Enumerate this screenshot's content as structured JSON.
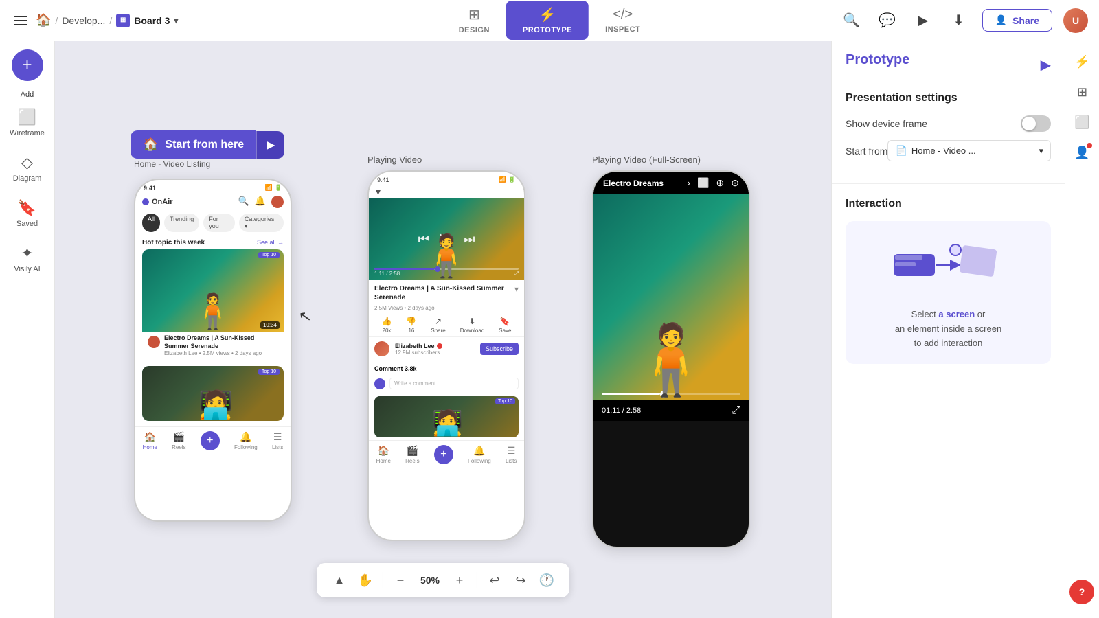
{
  "app": {
    "title": "Board 3"
  },
  "topnav": {
    "breadcrumb_home": "🏠",
    "breadcrumb_sep1": "/",
    "breadcrumb_develop": "Develop...",
    "breadcrumb_sep2": "/",
    "board_name": "Board 3",
    "tabs": [
      {
        "id": "design",
        "label": "DESIGN",
        "icon": "⊞",
        "active": false
      },
      {
        "id": "prototype",
        "label": "PROTOTYPE",
        "icon": "⚡",
        "active": true
      },
      {
        "id": "inspect",
        "label": "INSPECT",
        "icon": "</>",
        "active": false
      }
    ],
    "share_label": "Share"
  },
  "left_sidebar": {
    "add_label": "Add",
    "items": [
      {
        "id": "wireframe",
        "label": "Wireframe",
        "icon": "⬜"
      },
      {
        "id": "diagram",
        "label": "Diagram",
        "icon": "◇"
      },
      {
        "id": "saved",
        "label": "Saved",
        "icon": "🔖"
      },
      {
        "id": "visily-ai",
        "label": "Visily AI",
        "icon": "✦"
      }
    ]
  },
  "canvas": {
    "start_from_here": "Start from here",
    "home_label": "Home - Video Listing",
    "frames": [
      {
        "id": "home",
        "label": "Home - Video Listing",
        "top": "210",
        "left": "115",
        "content": {
          "time": "9:41",
          "app_name": "OnAir",
          "hot_topic": "Hot topic this week",
          "see_all": "See all",
          "video1_title": "Electro Dreams | A Sun-Kissed Summer Serenade",
          "video1_author": "Elizabeth Lee",
          "video1_meta": "2.5M views • 2 days ago",
          "video1_duration": "10:34",
          "top_badge": "Top 10"
        }
      },
      {
        "id": "playing",
        "label": "Playing Video",
        "top": "165",
        "left": "455",
        "content": {
          "time": "9:41",
          "time_current": "1:11 / 2:58",
          "title": "Electro Dreams | A Sun-Kissed Summer Serenade",
          "views": "2.5M Views • 2 days ago",
          "creator_name": "Elizabeth Lee",
          "creator_subs": "12.9M subscribers",
          "comments": "Comment 3.8k",
          "action_like": "20k",
          "action_dislike": "16",
          "action_share": "Share",
          "action_download": "Download",
          "action_save": "Save",
          "comment_placeholder": "Write a comment..."
        }
      },
      {
        "id": "fullscreen",
        "label": "Playing Video (Full-Screen)",
        "top": "165",
        "left": "782",
        "content": {
          "title": "Electro Dreams",
          "time_current": "01:11 / 2:58"
        }
      }
    ],
    "zoom": "50%",
    "toolbar": {
      "cursor_icon": "▲",
      "hand_icon": "✋",
      "minus_icon": "−",
      "zoom_label": "50%",
      "plus_icon": "+",
      "undo_icon": "↩",
      "redo_icon": "↪",
      "history_icon": "🕐"
    }
  },
  "right_panel": {
    "title": "Prototype",
    "presentation_settings": "Presentation settings",
    "show_device_frame": "Show device frame",
    "start_from_label": "Start from",
    "start_from_value": "Home - Video ...",
    "interaction_title": "Interaction",
    "interaction_hint_part1": "Select a screen or",
    "interaction_hint_part2": "an element inside a screen",
    "interaction_hint_part3": "to add interaction"
  }
}
